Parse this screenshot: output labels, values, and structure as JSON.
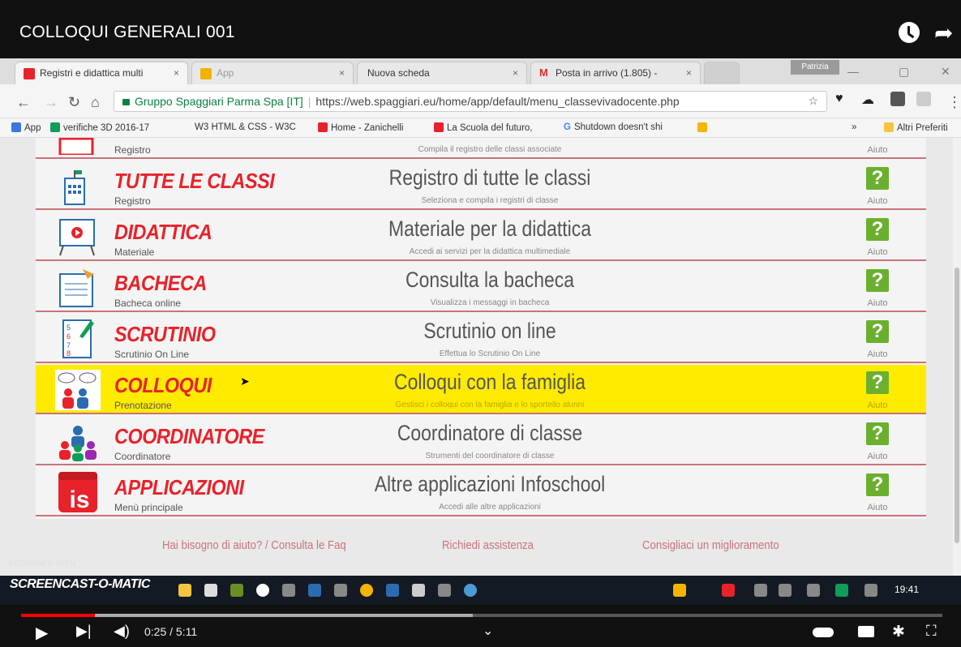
{
  "video": {
    "title": "COLLOQUI GENERALI 001",
    "time_current": "0:25",
    "time_total": "5:11",
    "time_sep": " / ",
    "progress_played": 0.08,
    "progress_loaded": 0.49
  },
  "browser": {
    "tabs": [
      {
        "label": "Registri e didattica multi",
        "color": "#e8222a",
        "active": true
      },
      {
        "label": "App",
        "color": "#f0b400",
        "active": false
      },
      {
        "label": "Nuova scheda",
        "color": "",
        "active": false
      },
      {
        "label": "Posta in arrivo (1.805) - ",
        "color": "#d93025",
        "active": false
      }
    ],
    "user_name": "Patrizia",
    "address": {
      "org": "Gruppo Spaggiari Parma Spa [IT]",
      "url": "https://web.spaggiari.eu/home/app/default/menu_classevivadocente.php"
    },
    "bookmarks": [
      {
        "label": "App",
        "color": "#3c78d8"
      },
      {
        "label": "verifiche 3D 2016-17",
        "color": "#0f9d58"
      },
      {
        "label": "W3 HTML & CSS - W3C",
        "color": "#1a4f8b"
      },
      {
        "label": "Home - Zanichelli",
        "color": "#e8222a"
      },
      {
        "label": "La Scuola del futuro,",
        "color": "#e8222a"
      },
      {
        "label": "Shutdown doesn't shi",
        "color": "#4285f4"
      },
      {
        "label": "",
        "color": "#f4b400"
      }
    ],
    "bookmarks_more": "»",
    "other_bookmarks": "Altri Preferiti"
  },
  "menu": {
    "rows": [
      {
        "name": "",
        "sub": "Registro",
        "title": "",
        "desc": "Compila il registro delle classi associate",
        "aiuto": "Aiuto",
        "help": "?"
      },
      {
        "name": "TUTTE LE CLASSI",
        "sub": "Registro",
        "title": "Registro di tutte le classi",
        "desc": "Seleziona e compila i registri di classe",
        "aiuto": "Aiuto",
        "help": "?"
      },
      {
        "name": "DIDATTICA",
        "sub": "Materiale",
        "title": "Materiale per la didattica",
        "desc": "Accedi ai servizi per la didattica multimediale",
        "aiuto": "Aiuto",
        "help": "?"
      },
      {
        "name": "BACHECA",
        "sub": "Bacheca online",
        "title": "Consulta la bacheca",
        "desc": "Visualizza i messaggi in bacheca",
        "aiuto": "Aiuto",
        "help": "?"
      },
      {
        "name": "SCRUTINIO",
        "sub": "Scrutinio On Line",
        "title": "Scrutinio on line",
        "desc": "Effettua lo Scrutinio On Line",
        "aiuto": "Aiuto",
        "help": "?"
      },
      {
        "name": "COLLOQUI",
        "sub": "Prenotazione",
        "title": "Colloqui con la famiglia",
        "desc": "Gestisci i colloqui con la famiglia e lo sportello alunni",
        "aiuto": "Aiuto",
        "help": "?"
      },
      {
        "name": "COORDINATORE",
        "sub": "Coordinatore",
        "title": "Coordinatore di classe",
        "desc": "Strumenti del coordinatore di classe",
        "aiuto": "Aiuto",
        "help": "?"
      },
      {
        "name": "APPLICAZIONI",
        "sub": "Menù principale",
        "title": "Altre applicazioni Infoschool",
        "desc": "Accedi alle altre applicazioni",
        "aiuto": "Aiuto",
        "help": "?"
      }
    ],
    "highlight_color": "#ffeb00",
    "accent_color": "#e8222a",
    "help_color": "#6ab02e"
  },
  "footer": {
    "faq": "Hai bisogno di aiuto? / Consulta le Faq",
    "assist": "Richiedi assistenza",
    "improve": "Consigliaci un miglioramento"
  },
  "recorder": {
    "badge": "RECORDED WITH",
    "logo": "SCREENCAST-O-MATIC"
  },
  "taskbar": {
    "clock": "19:41"
  },
  "icons": [
    "clock-icon",
    "share-icon",
    "back-icon",
    "forward-icon",
    "reload-icon",
    "home-icon",
    "lock-icon",
    "star-icon",
    "help-icon",
    "cursor-icon",
    "play-icon",
    "next-icon",
    "volume-icon",
    "autoplay-icon",
    "subtitles-icon",
    "settings-icon",
    "fullscreen-icon"
  ]
}
